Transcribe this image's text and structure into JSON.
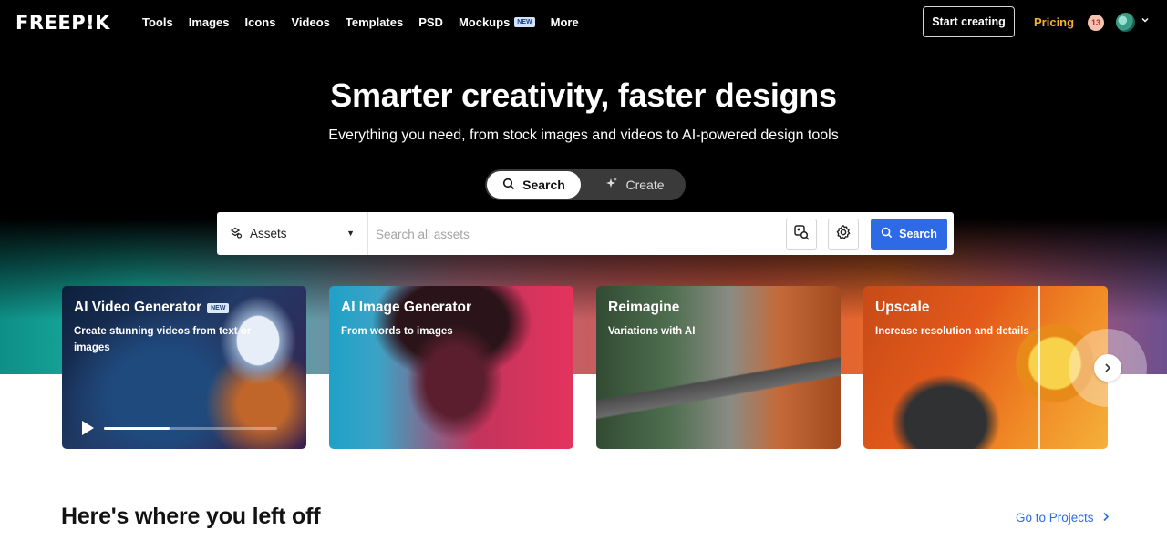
{
  "brand": {
    "logo": "FREEP!K"
  },
  "nav": {
    "links": [
      {
        "label": "Tools"
      },
      {
        "label": "Images"
      },
      {
        "label": "Icons"
      },
      {
        "label": "Videos"
      },
      {
        "label": "Templates"
      },
      {
        "label": "PSD"
      },
      {
        "label": "Mockups",
        "badge": "NEW"
      },
      {
        "label": "More"
      }
    ],
    "start_creating": "Start creating",
    "pricing": "Pricing",
    "notification_count": "13"
  },
  "hero": {
    "headline": "Smarter creativity, faster designs",
    "subline": "Everything you need, from stock images and videos to AI-powered design tools",
    "toggle": {
      "search": "Search",
      "create": "Create"
    }
  },
  "searchbar": {
    "category": "Assets",
    "placeholder": "Search all assets",
    "button": "Search"
  },
  "cards": [
    {
      "title": "AI Video Generator",
      "badge": "NEW",
      "subtitle": "Create stunning videos from text or images",
      "progress": 0.38
    },
    {
      "title": "AI Image Generator",
      "subtitle": "From words to images"
    },
    {
      "title": "Reimagine",
      "subtitle": "Variations with AI"
    },
    {
      "title": "Upscale",
      "subtitle": "Increase resolution and details"
    }
  ],
  "left_off": {
    "title": "Here's where you left off",
    "link": "Go to Projects"
  },
  "colors": {
    "accent": "#2e6ae6",
    "pricing": "#f6b233",
    "hero_bg": "#000000"
  }
}
